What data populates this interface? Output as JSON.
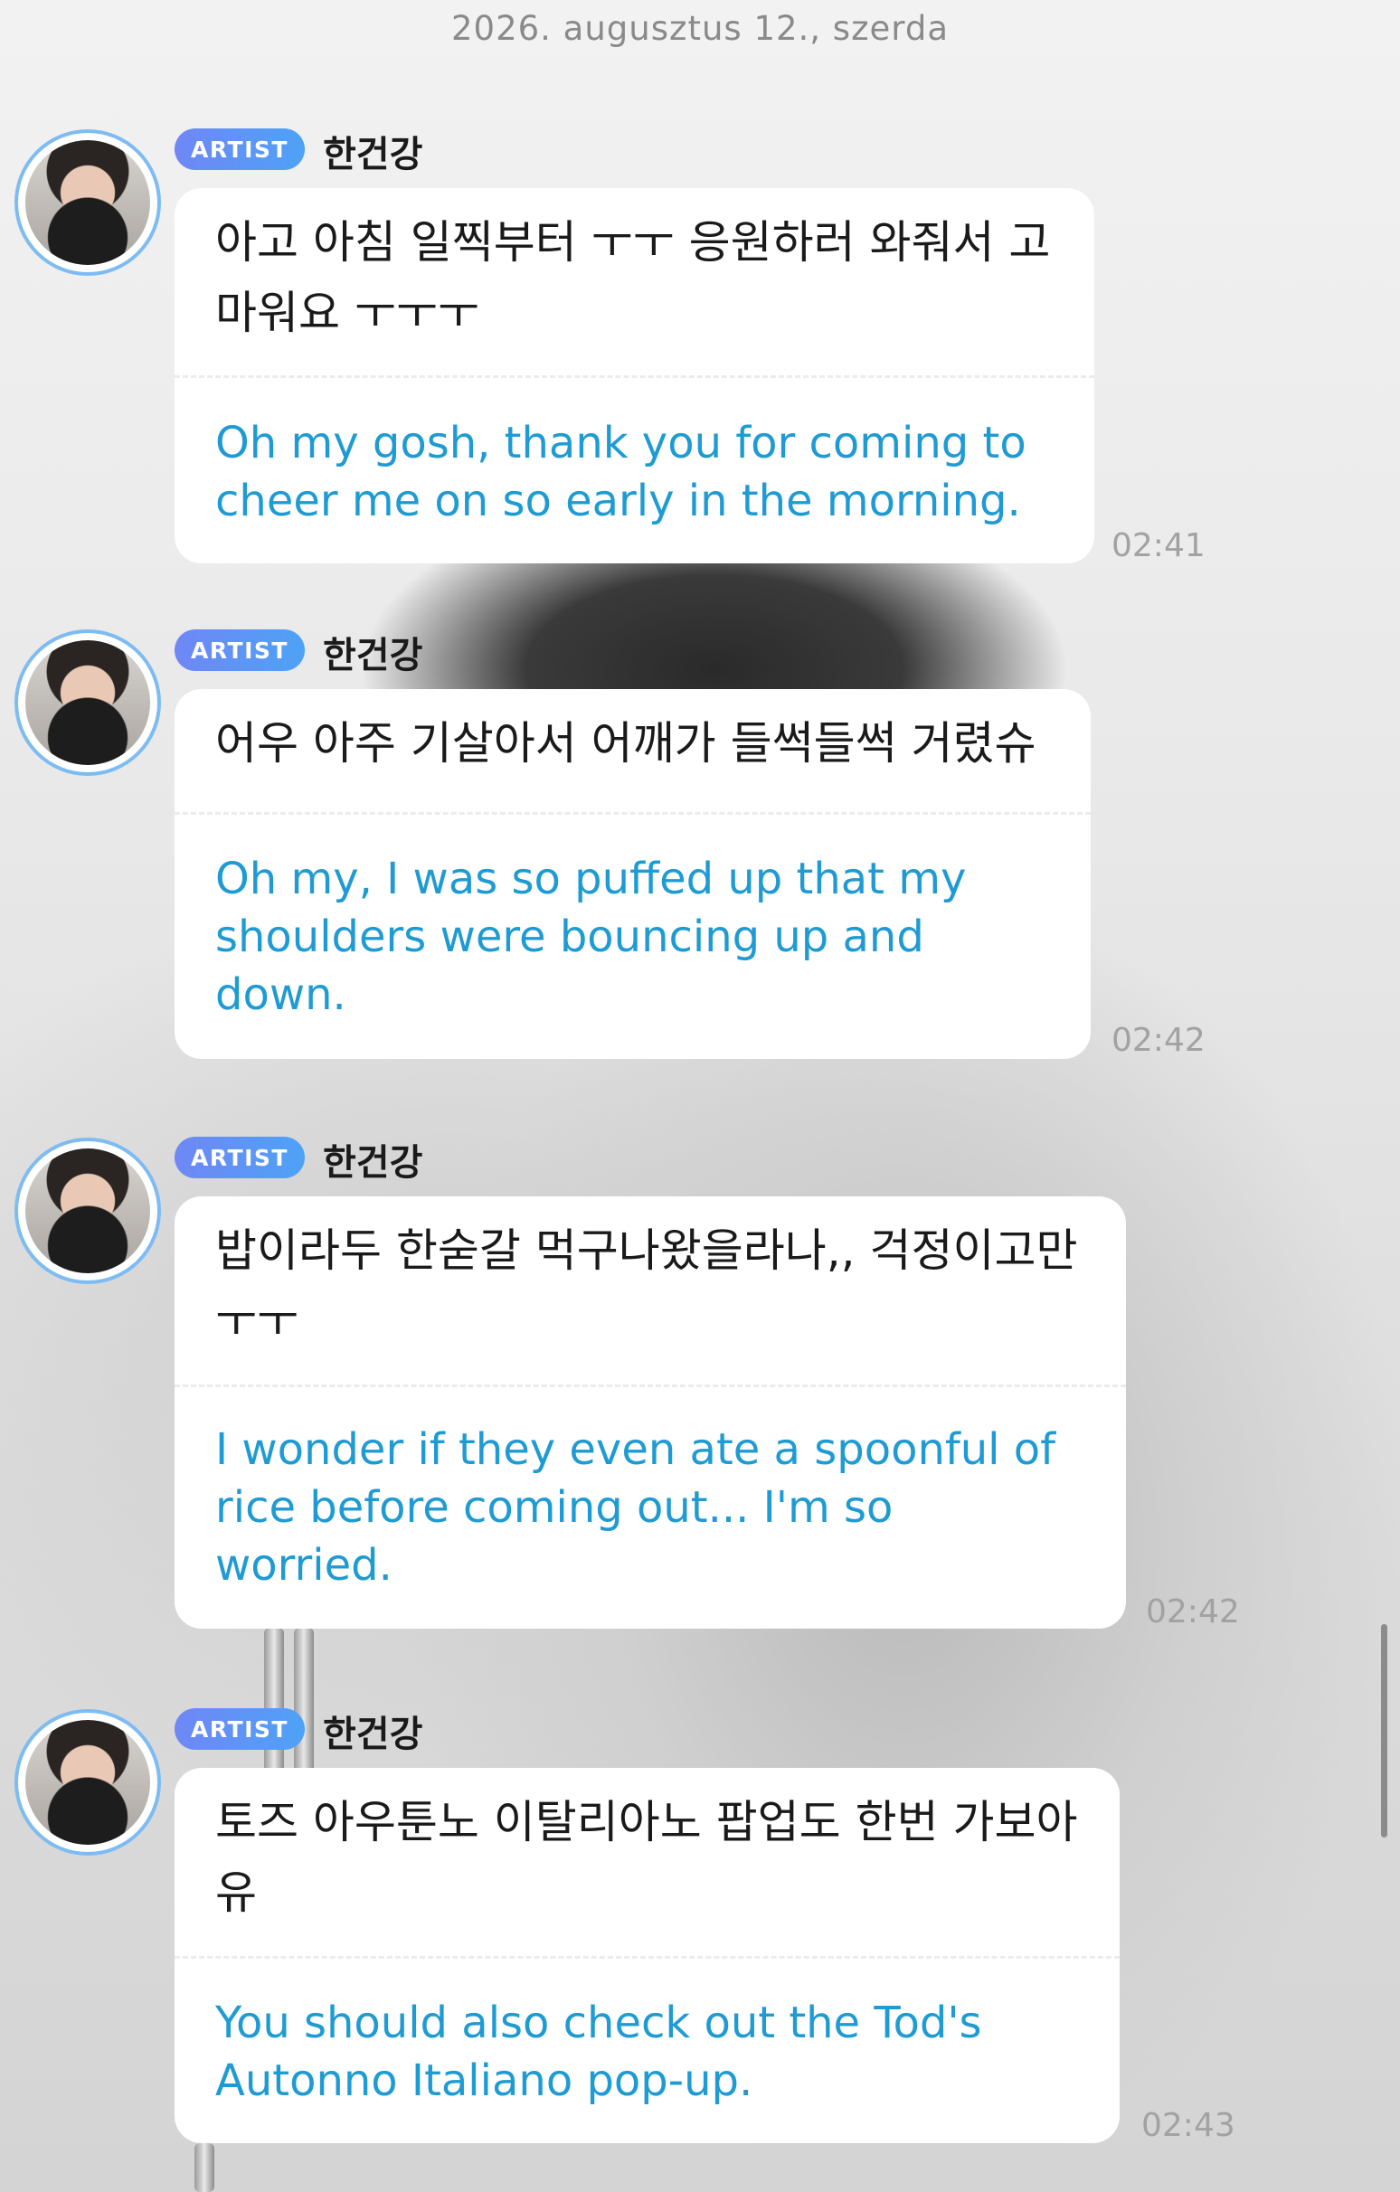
{
  "date_header": "2026. augusztus 12., szerda",
  "messages": [
    {
      "badge": "ARTIST",
      "sender": "한건강",
      "korean": [
        "아고 아침 일찍부터 ㅜㅜ 응원하러 와줘서 고",
        "마워요 ㅜㅜㅜ"
      ],
      "english": [
        "Oh my gosh, thank you for coming to",
        "cheer me on so early in the morning."
      ],
      "time": "02:41"
    },
    {
      "badge": "ARTIST",
      "sender": "한건강",
      "korean": [
        "어우 아주 기살아서 어깨가 들썩들썩 거렸슈"
      ],
      "english": [
        "Oh my, I was so puffed up that my",
        "shoulders were bouncing up and",
        "down."
      ],
      "time": "02:42"
    },
    {
      "badge": "ARTIST",
      "sender": "한건강",
      "korean": [
        "밥이라두 한숟갈 먹구나왔을라나,, 걱정이고만",
        "ㅜㅜ"
      ],
      "english": [
        "I wonder if they even ate a spoonful of",
        "rice before coming out... I'm so",
        "worried."
      ],
      "time": "02:42"
    },
    {
      "badge": "ARTIST",
      "sender": "한건강",
      "korean": [
        "토즈 아우툰노 이탈리아노 팝업도 한번 가보아",
        "유"
      ],
      "english": [
        "You should also check out the Tod's",
        "Autonno Italiano pop-up."
      ],
      "time": "02:43"
    }
  ]
}
